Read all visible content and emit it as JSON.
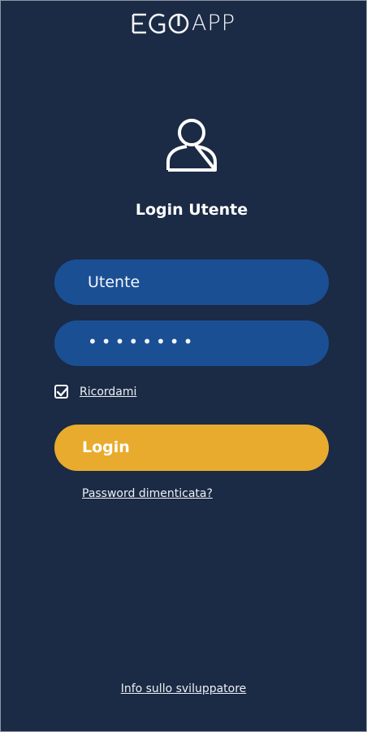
{
  "app": {
    "logo_text": "APP"
  },
  "login": {
    "title": "Login Utente",
    "username_value": "Utente",
    "password_mask": "••••••••",
    "remember_label": "Ricordami",
    "remember_checked": true,
    "login_button_label": "Login",
    "forgot_password_label": "Password dimenticata?",
    "developer_info_label": "Info sullo sviluppatore"
  },
  "colors": {
    "background": "#1b2a45",
    "field_background": "#1b4f94",
    "login_button": "#e8ab2e",
    "text": "#ffffff"
  },
  "icons": {
    "user": "user-icon",
    "checkbox": "checkbox-checked-icon"
  }
}
